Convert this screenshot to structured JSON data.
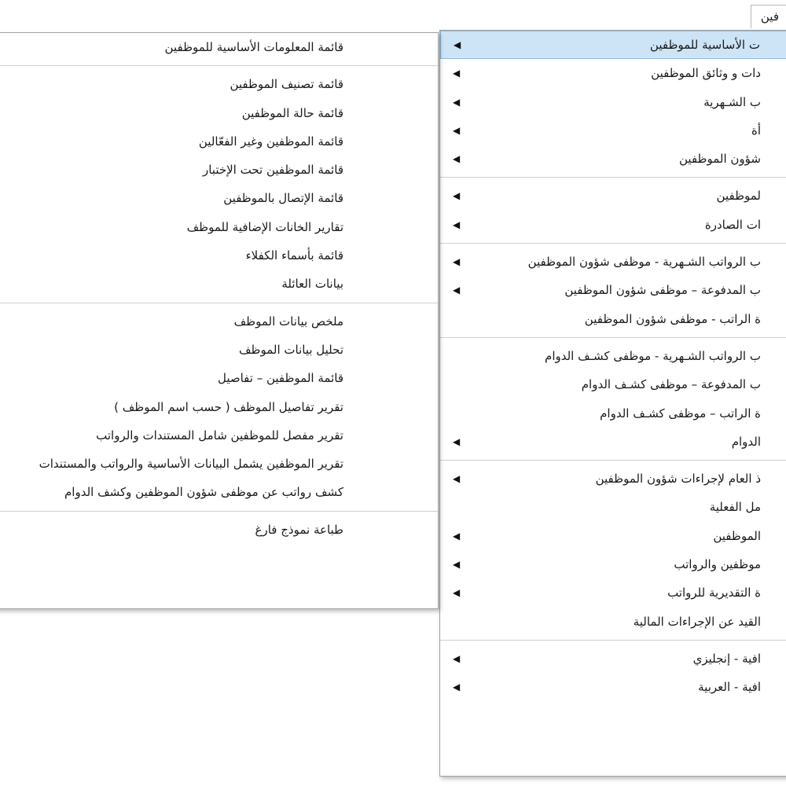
{
  "menubar": {
    "tab_label": "فين"
  },
  "main_menu": {
    "groups": [
      [
        {
          "label": "ت الأساسية للموظفين",
          "has_submenu": true,
          "highlighted": true
        },
        {
          "label": "دات و وثائق الموظفين",
          "has_submenu": true
        },
        {
          "label": "ب الشـهرية",
          "has_submenu": true
        },
        {
          "label": "أة",
          "has_submenu": true
        },
        {
          "label": "شؤون الموظفين",
          "has_submenu": true
        }
      ],
      [
        {
          "label": "لموظفين",
          "has_submenu": true
        },
        {
          "label": "ات الصادرة",
          "has_submenu": true
        }
      ],
      [
        {
          "label": "ب الرواتب الشـهرية - موظفى شؤون الموظفين",
          "has_submenu": true
        },
        {
          "label": "ب المدفوعة – موظفى شؤون الموظفين",
          "has_submenu": true
        },
        {
          "label": "ة الراتب - موظفى شؤون الموظفين",
          "has_submenu": false
        }
      ],
      [
        {
          "label": "ب الرواتب الشـهرية - موظفى كشـف الدوام",
          "has_submenu": false
        },
        {
          "label": "ب المدفوعة – موظفى كشـف الدوام",
          "has_submenu": false
        },
        {
          "label": "ة الراتب – موظفى كشـف الدوام",
          "has_submenu": false
        },
        {
          "label": "الدوام",
          "has_submenu": true
        }
      ],
      [
        {
          "label": "ذ العام لإجراءات شؤون الموظفين",
          "has_submenu": true
        },
        {
          "label": "مل الفعلية",
          "has_submenu": false
        },
        {
          "label": "الموظفين",
          "has_submenu": true
        },
        {
          "label": "موظفين والرواتب",
          "has_submenu": true
        },
        {
          "label": "ة التقديرية للرواتب",
          "has_submenu": true
        },
        {
          "label": "القيد عن الإجراءات  المالية",
          "has_submenu": false
        }
      ],
      [
        {
          "label": "افية - إنجليزي",
          "has_submenu": true
        },
        {
          "label": "افية - العربية",
          "has_submenu": true
        }
      ]
    ]
  },
  "sub_menu": {
    "groups": [
      [
        {
          "label": "قائمة المعلومات الأساسية للموظفين"
        }
      ],
      [
        {
          "label": "قائمة تصنيف الموظفين"
        },
        {
          "label": "قائمة حالة الموظفين"
        },
        {
          "label": "قائمة الموظفين وغير الفعّالين"
        },
        {
          "label": "قائمة الموظفين تحت الإختبار"
        },
        {
          "label": "قائمة الإتصال بالموظفين"
        },
        {
          "label": "تقارير الخانات الإضافية للموظف"
        },
        {
          "label": "قائمة بأسماء الكفلاء"
        },
        {
          "label": "بيانات العائلة"
        }
      ],
      [
        {
          "label": "ملخص بيانات الموظف"
        },
        {
          "label": "تحليل بيانات الموظف"
        },
        {
          "label": "قائمة الموظفين – تفاصيل"
        },
        {
          "label": "تقرير تفاصيل الموظف ( حسب اسم الموظف )"
        },
        {
          "label": "تقرير مفصل للموظفين شامل المستندات والرواتب"
        },
        {
          "label": "تقرير الموظفين يشمل البيانات الأساسية والرواتب والمستندات"
        },
        {
          "label": "كشف رواتب عن موظفى شؤون الموظفين وكشف الدوام"
        }
      ],
      [
        {
          "label": "طباعة نموذج فارغ"
        }
      ]
    ]
  }
}
